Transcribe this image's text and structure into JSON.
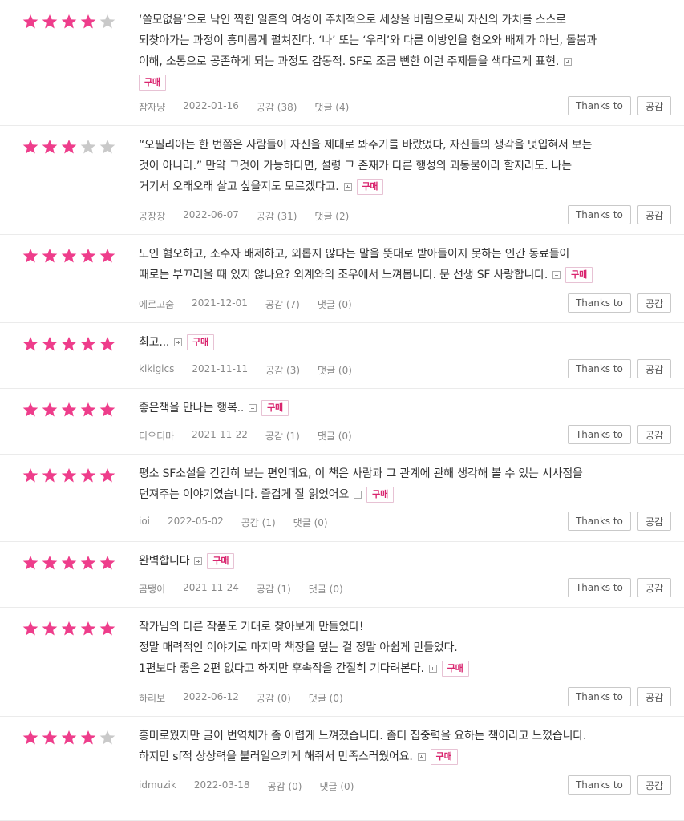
{
  "labels": {
    "buy": "구매",
    "thanks": "Thanks to",
    "like": "공감"
  },
  "reviews": [
    {
      "rating": 4,
      "lines": [
        "‘쓸모없음’으로 낙인 찍힌 일흔의 여성이 주체적으로 세상을 버림으로써 자신의 가치를 스스로",
        "되찾아가는 과정이 흥미롭게 펼쳐진다. ‘나’ 또는 ‘우리’와 다른 이방인을 혐오와 배제가 아닌, 돌봄과",
        "이해, 소통으로 공존하게 되는 과정도 감동적. SF로 조금 뻔한 이런 주제들을 색다르게 표현."
      ],
      "buy_on_own_line": true,
      "author": "잠자냥",
      "date": "2022-01-16",
      "likes": "공감 (38)",
      "comments": "댓글 (4)"
    },
    {
      "rating": 3,
      "lines": [
        "“오필리아는 한 번쯤은 사람들이 자신을 제대로 봐주기를 바랐었다, 자신들의 생각을 덧입혀서 보는",
        "것이 아니라.” 만약 그것이 가능하다면, 설령 그 존재가 다른 행성의 괴동물이라 할지라도. 나는",
        "거기서 오래오래 살고 싶을지도 모르겠다고."
      ],
      "author": "공장장",
      "date": "2022-06-07",
      "likes": "공감 (31)",
      "comments": "댓글 (2)"
    },
    {
      "rating": 5,
      "lines": [
        "노인 혐오하고, 소수자 배제하고, 외롭지 않다는 말을 뜻대로 받아들이지 못하는 인간 동료들이",
        "때로는 부끄러울 때 있지 않나요? 외계와의 조우에서 느껴봅니다. 문 선생 SF 사랑합니다."
      ],
      "author": "에르고숨",
      "date": "2021-12-01",
      "likes": "공감 (7)",
      "comments": "댓글 (0)"
    },
    {
      "rating": 5,
      "lines": [
        "최고..."
      ],
      "author": "kikigics",
      "date": "2021-11-11",
      "likes": "공감 (3)",
      "comments": "댓글 (0)"
    },
    {
      "rating": 5,
      "lines": [
        "좋은책을 만나는 행복.."
      ],
      "author": "디오티마",
      "date": "2021-11-22",
      "likes": "공감 (1)",
      "comments": "댓글 (0)"
    },
    {
      "rating": 5,
      "lines": [
        "평소 SF소설을 간간히 보는 편인데요, 이 책은 사람과 그 관계에 관해 생각해 볼 수 있는 시사점을",
        "던져주는 이야기였습니다. 즐겁게 잘 읽었어요"
      ],
      "author": "ioi",
      "date": "2022-05-02",
      "likes": "공감 (1)",
      "comments": "댓글 (0)"
    },
    {
      "rating": 5,
      "lines": [
        "완벽합니다"
      ],
      "author": "곰탱이",
      "date": "2021-11-24",
      "likes": "공감 (1)",
      "comments": "댓글 (0)"
    },
    {
      "rating": 5,
      "lines": [
        "작가님의 다른 작품도 기대로 찾아보게 만들었다!",
        "정말 매력적인 이야기로 마지막 책장을 덮는 걸 정말 아쉽게 만들었다.",
        "1편보다 좋은 2편 없다고 하지만 후속작을 간절히 기다려본다."
      ],
      "author": "하리보",
      "date": "2022-06-12",
      "likes": "공감 (0)",
      "comments": "댓글 (0)"
    },
    {
      "rating": 4,
      "lines": [
        "흥미로웠지만 글이 번역체가 좀 어렵게 느껴졌습니다. 좀더 집중력을 요하는 책이라고 느꼈습니다.",
        "하지만 sf적 상상력을 불러일으키게 해줘서 만족스러웠어요."
      ],
      "author": "idmuzik",
      "date": "2022-03-18",
      "likes": "공감 (0)",
      "comments": "댓글 (0)"
    }
  ]
}
